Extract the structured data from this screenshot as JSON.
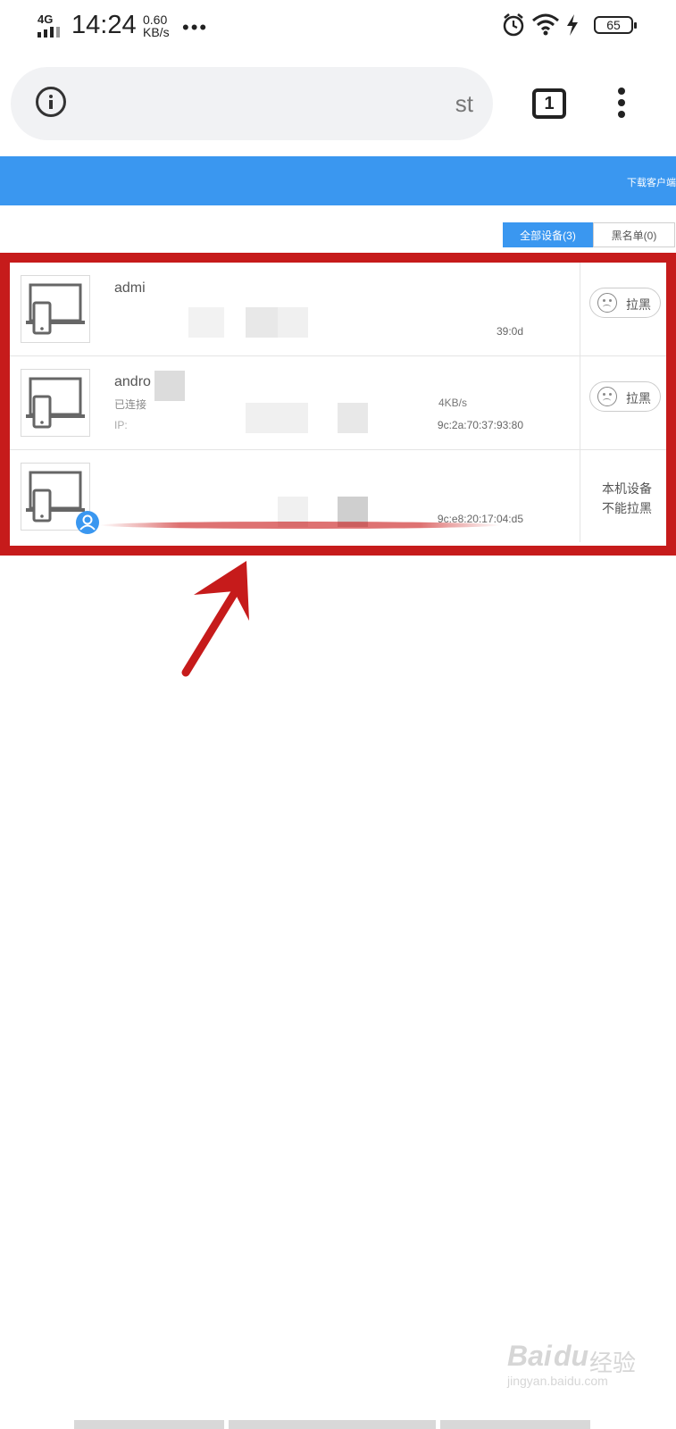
{
  "status_bar": {
    "network": "4G",
    "time": "14:24",
    "speed_value": "0.60",
    "speed_unit": "KB/s",
    "more": "•••",
    "battery": "65"
  },
  "browser": {
    "url_fragment": "st",
    "tab_count": "1"
  },
  "header": {
    "download_link": "下载客户端"
  },
  "tabs": [
    {
      "label": "全部设备(3)",
      "active": true
    },
    {
      "label": "黑名单(0)",
      "active": false
    }
  ],
  "devices": [
    {
      "name": "admi",
      "mac_fragment": "39:0d",
      "action": "拉黑"
    },
    {
      "name": "andro",
      "status": "已连接",
      "speed_fragment": "4KB/s",
      "ip_fragment": "IP:",
      "mac_fragment": "9c:2a:70:37:93:80",
      "action": "拉黑"
    },
    {
      "name": "",
      "mac_fragment": "9c:e8:20:17:04:d5",
      "local_note_line1": "本机设备",
      "local_note_line2": "不能拉黑"
    }
  ],
  "watermark": {
    "logo": "Bai",
    "logo2": "du",
    "cn": "经验",
    "url": "jingyan.baidu.com"
  },
  "colors": {
    "accent_blue": "#3a97f0",
    "annotation_red": "#c61b1b"
  }
}
